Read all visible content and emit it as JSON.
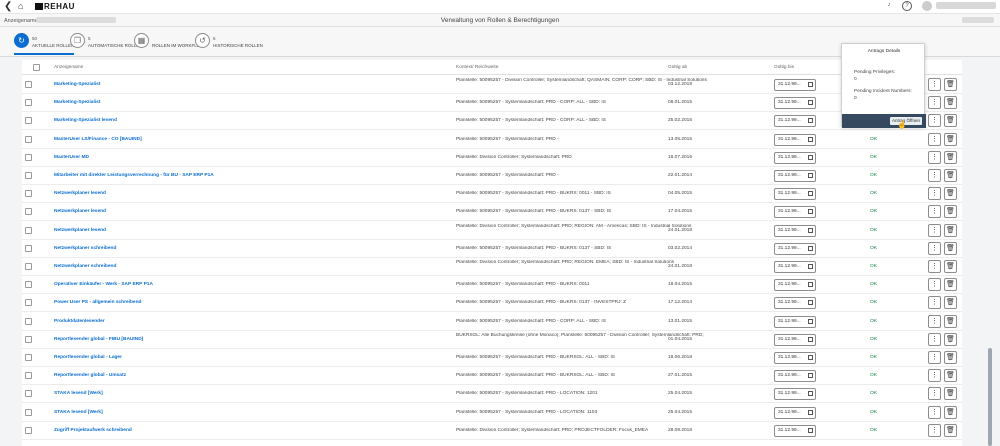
{
  "brand": "REHAU",
  "header": {
    "field_label": "Anzeigename",
    "title": "Verwaltung von Rollen & Berechtigungen"
  },
  "tabs": [
    {
      "count": "50",
      "label": "Aktuelle Rollen",
      "icon": "refresh-icon"
    },
    {
      "count": "5",
      "label": "Automatische Rollen",
      "icon": "copy-icon"
    },
    {
      "count": "",
      "label": "Rollen im Workflow",
      "icon": "calendar-icon"
    },
    {
      "count": "6",
      "label": "Historische Rollen",
      "icon": "history-icon"
    }
  ],
  "table": {
    "columns": [
      "Anzeigename",
      "Kontext/ Reichweite",
      "Gültig ab",
      "Gültig bis"
    ],
    "rows": [
      {
        "name": "Marketing-Spezialist",
        "context": "Planstelle: 50095257 - Division Controller; Systemlandschaft: QASMAIN; CORP: CORP; SBD: IS - Industrial Solutions",
        "valid_from": "03.12.2019",
        "valid_to": "31.12.99...",
        "status": ""
      },
      {
        "name": "Marketing-Spezialist",
        "context": "Planstelle: 50095257 - Systemlandschaft: PRD - CORP: ALL - SBD: IS",
        "valid_from": "08.01.2015",
        "valid_to": "31.12.99...",
        "status": ""
      },
      {
        "name": "Marketing-Spezialist lesend",
        "context": "Planstelle: 50095257 - Systemlandschaft: PRD - CORP: ALL - SBD: IS",
        "valid_from": "25.02.2015",
        "valid_to": "31.12.99...",
        "status": ""
      },
      {
        "name": "MasterUser LS/Finance - CO [BAUIND]",
        "context": "Planstelle: 50095257 - Systemlandschaft: PRD -",
        "valid_from": "13.05.2015",
        "valid_to": "31.12.99...",
        "status": "OK"
      },
      {
        "name": "MasterUser MD",
        "context": "Planstelle: Division Controller; Systemlandschaft: PRD",
        "valid_from": "18.07.2016",
        "valid_to": "31.12.99...",
        "status": "OK"
      },
      {
        "name": "Mitarbeiter mit direkter Leistungsverrechnung - für BU - SAP ERP P1A",
        "context": "Planstelle: 50095257 - Systemlandschaft: PRD -",
        "valid_from": "22.01.2014",
        "valid_to": "31.12.99...",
        "status": "OK"
      },
      {
        "name": "Netzwerkplaner lesend",
        "context": "Planstelle: 50095257 - Systemlandschaft: PRD - BUKRS: 0011 - SBD: IS",
        "valid_from": "04.05.2015",
        "valid_to": "31.12.99...",
        "status": "OK"
      },
      {
        "name": "Netzwerkplaner lesend",
        "context": "Planstelle: 50095257 - Systemlandschaft: PRD - BUKRS: 0137 - SBD: IS",
        "valid_from": "17.04.2015",
        "valid_to": "31.12.99...",
        "status": "OK"
      },
      {
        "name": "Netzwerkplaner lesend",
        "context": "Planstelle: Division Controller; Systemlandschaft: PRD; REGION: AM - Americas; SBD: IS - Industrial Solutions",
        "valid_from": "24.01.2018",
        "valid_to": "31.12.99...",
        "status": "OK"
      },
      {
        "name": "Netzwerkplaner schreibend",
        "context": "Planstelle: 50095257 - Systemlandschaft: PRD - BUKRS: 0137 - SBD: IS",
        "valid_from": "03.02.2014",
        "valid_to": "31.12.99...",
        "status": "OK"
      },
      {
        "name": "Netzwerkplaner schreibend",
        "context": "Planstelle: Division Controller; Systemlandschaft: PRD; REGION: EMEA; SBD: IS - Industrial Solutions",
        "valid_from": "24.01.2018",
        "valid_to": "31.12.99...",
        "status": "OK"
      },
      {
        "name": "Operativer Einkäufer - Werk - SAP ERP P1A",
        "context": "Planstelle: 50095257 - Systemlandschaft: PRD - BUKRS: 0011",
        "valid_from": "18.04.2015",
        "valid_to": "31.12.99...",
        "status": "OK"
      },
      {
        "name": "Power User PS - allgemein schreibend",
        "context": "Planstelle: 50095257 - Systemlandschaft: PRD - BUKRS: 0137 - INVESTPRJ: Z",
        "valid_from": "17.12.2014",
        "valid_to": "31.12.99...",
        "status": "OK"
      },
      {
        "name": "Produktdatenlesender",
        "context": "Planstelle: 50095257 - Systemlandschaft: PRD - CORP: ALL - SBD: IS",
        "valid_from": "13.01.2015",
        "valid_to": "31.12.99...",
        "status": "OK"
      },
      {
        "name": "Reportlesender global - FIBU [BAUIND]",
        "context": "BUKRSGL: Alle Buchungskreise (ohne Monaco); Planstelle: 50095257 - Division Controller; Systemlandschaft: PRD;",
        "valid_from": "01.04.2015",
        "valid_to": "31.12.99...",
        "status": "OK"
      },
      {
        "name": "Reportlesender global - Lager",
        "context": "Planstelle: 50095257 - Systemlandschaft: PRD - BUKRSGL: ALL - SBD: IS",
        "valid_from": "18.06.2018",
        "valid_to": "31.12.99...",
        "status": "OK"
      },
      {
        "name": "Reportlesender global - Umsatz",
        "context": "Planstelle: 50095257 - Systemlandschaft: PRD - BUKRSGL: ALL - SBD: IS",
        "valid_from": "27.01.2015",
        "valid_to": "31.12.99...",
        "status": "OK"
      },
      {
        "name": "STAKA lesend [Werk]",
        "context": "Planstelle: 50095257 - Systemlandschaft: PRD - LOCATION: 1201",
        "valid_from": "25.04.2015",
        "valid_to": "31.12.99...",
        "status": "OK"
      },
      {
        "name": "STAKA lesend [Werk]",
        "context": "Planstelle: 50095257 - Systemlandschaft: PRD - LOCATION: 1103",
        "valid_from": "25.04.2015",
        "valid_to": "31.12.99...",
        "status": "OK"
      },
      {
        "name": "Zugriff Projektaufwerk schreibend",
        "context": "Planstelle: Division Controller; Systemlandschaft: PRD; PROJECTFOLDER: Focus_EMEA",
        "valid_from": "28.09.2018",
        "valid_to": "31.12.99...",
        "status": "OK"
      }
    ]
  },
  "popover": {
    "title": "Antrags Details",
    "pending_privileges_label": "Pending Privileges:",
    "pending_privileges_value": "0",
    "pending_incident_label": "Pending Incident Numbers:",
    "pending_incident_value": "0",
    "open_button": "Antrag Öffnen"
  }
}
